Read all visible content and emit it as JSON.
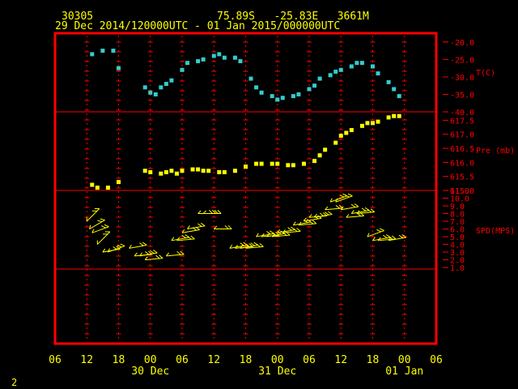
{
  "header": {
    "station": "30305",
    "location": "75.89S   -25.83E   3661M",
    "time_range": "29 Dec 2014/120000UTC - 01 Jan 2015/000000UTC"
  },
  "footer": {
    "page_number": "2"
  },
  "colors": {
    "frame": "#ff0000",
    "temperature": "#33cccc",
    "pressure": "#ffff00",
    "wind": "#ffff00",
    "axis_text": "#ffff00",
    "panel_text": "#ff0000"
  },
  "x_axis": {
    "hour_ticks": [
      "06",
      "12",
      "18",
      "00",
      "06",
      "12",
      "18",
      "00",
      "06",
      "12",
      "18",
      "00",
      "06"
    ],
    "hour_values": [
      6,
      12,
      18,
      24,
      30,
      36,
      42,
      48,
      54,
      60,
      66,
      72,
      78
    ],
    "date_labels": [
      {
        "label": "30 Dec",
        "hour": 24
      },
      {
        "label": "31 Dec",
        "hour": 48
      },
      {
        "label": "01 Jan",
        "hour": 72
      }
    ],
    "range": [
      6,
      78
    ]
  },
  "chart_data": [
    {
      "type": "scatter",
      "panel": "temperature",
      "ylabel": "T(C)",
      "yticks": [
        "-20.0",
        "-25.0",
        "-30.0",
        "-35.0",
        "-40.0"
      ],
      "ylim": [
        -40,
        -17.5
      ],
      "x_unit": "hours since 29 Dec 2014 00 UTC",
      "series": [
        {
          "x": [
            13,
            15,
            17,
            18,
            23,
            24,
            25,
            26,
            27,
            28,
            30,
            31,
            33,
            34,
            36,
            37,
            38,
            40,
            41,
            43,
            44,
            45,
            47,
            48,
            49,
            51,
            52,
            54,
            55,
            56,
            58,
            59,
            60,
            62,
            63,
            64,
            66,
            67,
            69,
            70,
            71
          ],
          "y": [
            -23.5,
            -22.5,
            -22.5,
            -27.5,
            -33.0,
            -34.5,
            -35.0,
            -33.0,
            -32.0,
            -31.0,
            -28.0,
            -26.0,
            -25.5,
            -25.0,
            -24.0,
            -23.5,
            -24.5,
            -24.5,
            -25.5,
            -30.5,
            -33.0,
            -34.5,
            -35.5,
            -36.5,
            -36.0,
            -35.5,
            -35.0,
            -33.5,
            -32.5,
            -30.5,
            -29.5,
            -28.5,
            -28.0,
            -27.0,
            -26.0,
            -26.0,
            -27.0,
            -29.0,
            -31.5,
            -33.5,
            -35.5
          ]
        }
      ]
    },
    {
      "type": "scatter",
      "panel": "pressure",
      "ylabel": "Pre (mb)",
      "yticks": [
        "617.5",
        "617.0",
        "616.5",
        "616.0",
        "615.5",
        "615.0"
      ],
      "ylim": [
        615.0,
        617.8
      ],
      "series": [
        {
          "x": [
            13,
            14,
            16,
            18,
            23,
            24,
            26,
            27,
            28,
            29,
            30,
            32,
            33,
            34,
            35,
            37,
            38,
            40,
            42,
            44,
            45,
            47,
            48,
            50,
            51,
            53,
            55,
            56,
            57,
            59,
            60,
            61,
            62,
            64,
            65,
            66,
            67,
            69,
            70,
            71
          ],
          "y": [
            615.2,
            615.1,
            615.1,
            615.3,
            615.7,
            615.65,
            615.6,
            615.65,
            615.7,
            615.6,
            615.7,
            615.75,
            615.75,
            615.7,
            615.7,
            615.65,
            615.65,
            615.7,
            615.85,
            615.95,
            615.95,
            615.95,
            615.95,
            615.9,
            615.9,
            615.95,
            616.05,
            616.25,
            616.45,
            616.7,
            616.95,
            617.05,
            617.15,
            617.3,
            617.4,
            617.4,
            617.45,
            617.6,
            617.65,
            617.65
          ]
        }
      ]
    },
    {
      "type": "scatter",
      "panel": "wind",
      "ylabel": "SPD(MPS)",
      "yticks": [
        "11.0",
        "10.0",
        "9.0",
        "8.0",
        "7.0",
        "6.0",
        "5.0",
        "4.0",
        "3.0",
        "2.0",
        "1.0"
      ],
      "ylim": [
        0.8,
        11.0
      ],
      "note": "wind barbs; y = speed (m/s), dir = direction in degrees",
      "series": [
        {
          "x": [
            12,
            12.5,
            13,
            14,
            15,
            16,
            20,
            21,
            22,
            23,
            27,
            28,
            29,
            30,
            31,
            33,
            34,
            36,
            39,
            40,
            41,
            42,
            44,
            45,
            46,
            47,
            48,
            49,
            51,
            52,
            53,
            54,
            55,
            57,
            58,
            59,
            60,
            61,
            62,
            63,
            65,
            66,
            67,
            69
          ],
          "y": [
            7.0,
            6.0,
            5.5,
            4.0,
            3.0,
            3.0,
            3.5,
            2.5,
            2.5,
            2.0,
            2.5,
            4.5,
            4.5,
            5.5,
            6.0,
            8.0,
            8.0,
            6.0,
            3.5,
            3.5,
            3.5,
            3.5,
            5.0,
            5.0,
            5.0,
            5.0,
            5.5,
            5.5,
            6.5,
            6.5,
            7.0,
            7.5,
            7.5,
            8.5,
            9.5,
            9.5,
            8.5,
            7.5,
            8.0,
            8.0,
            5.0,
            4.5,
            4.5,
            4.5
          ],
          "dir": [
            45,
            60,
            70,
            45,
            80,
            70,
            80,
            85,
            80,
            85,
            85,
            80,
            85,
            80,
            80,
            90,
            90,
            90,
            80,
            85,
            80,
            85,
            80,
            85,
            80,
            85,
            80,
            85,
            80,
            85,
            80,
            85,
            80,
            85,
            70,
            70,
            80,
            85,
            80,
            85,
            70,
            80,
            85,
            80
          ]
        }
      ]
    }
  ]
}
